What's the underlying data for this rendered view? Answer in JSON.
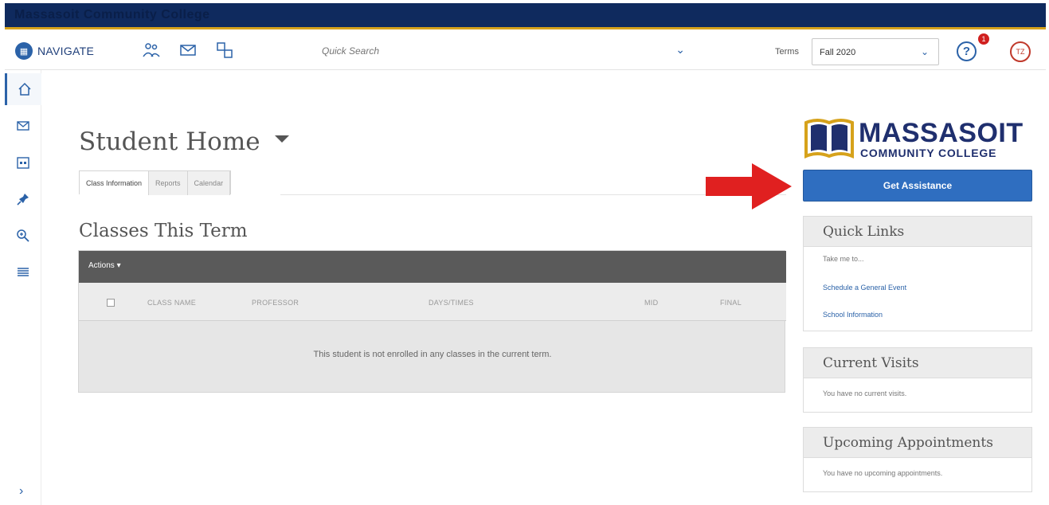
{
  "topbar": {
    "title": "Massasoit Community College"
  },
  "navbar": {
    "brand": "NAVIGATE",
    "search_placeholder": "Quick Search",
    "terms_label": "Terms",
    "terms_value": "Fall 2020",
    "help_label": "?",
    "help_badge": "1",
    "avatar_initials": "TZ"
  },
  "sidebar": {
    "items": [
      {
        "icon": "home-icon"
      },
      {
        "icon": "mail-icon"
      },
      {
        "icon": "calendar-icon"
      },
      {
        "icon": "pin-icon"
      },
      {
        "icon": "zoom-icon"
      },
      {
        "icon": "list-icon"
      }
    ],
    "expand": "›"
  },
  "main": {
    "title": "Student Home",
    "tabs": [
      {
        "label": "Class Information",
        "active": true
      },
      {
        "label": "Reports",
        "active": false
      },
      {
        "label": "Calendar",
        "active": false
      }
    ],
    "classes_title": "Classes This Term",
    "actions_label": "Actions ▾",
    "columns": [
      "CLASS NAME",
      "PROFESSOR",
      "DAYS/TIMES",
      "MID",
      "FINAL"
    ],
    "empty_message": "This student is not enrolled in any classes in the current term."
  },
  "rail": {
    "logo_main": "MASSASOIT",
    "logo_sub": "COMMUNITY COLLEGE",
    "assist_button": "Get Assistance",
    "quick_links": {
      "title": "Quick Links",
      "intro": "Take me to...",
      "links": [
        "Schedule a General Event",
        "School Information"
      ]
    },
    "current_visits": {
      "title": "Current Visits",
      "body": "You have no current visits."
    },
    "upcoming": {
      "title": "Upcoming Appointments",
      "body": "You have no upcoming appointments."
    }
  },
  "colors": {
    "navy": "#0f2a5e",
    "gold": "#d6a21b",
    "accent": "#2f6ec0",
    "arrow": "#e02020"
  }
}
